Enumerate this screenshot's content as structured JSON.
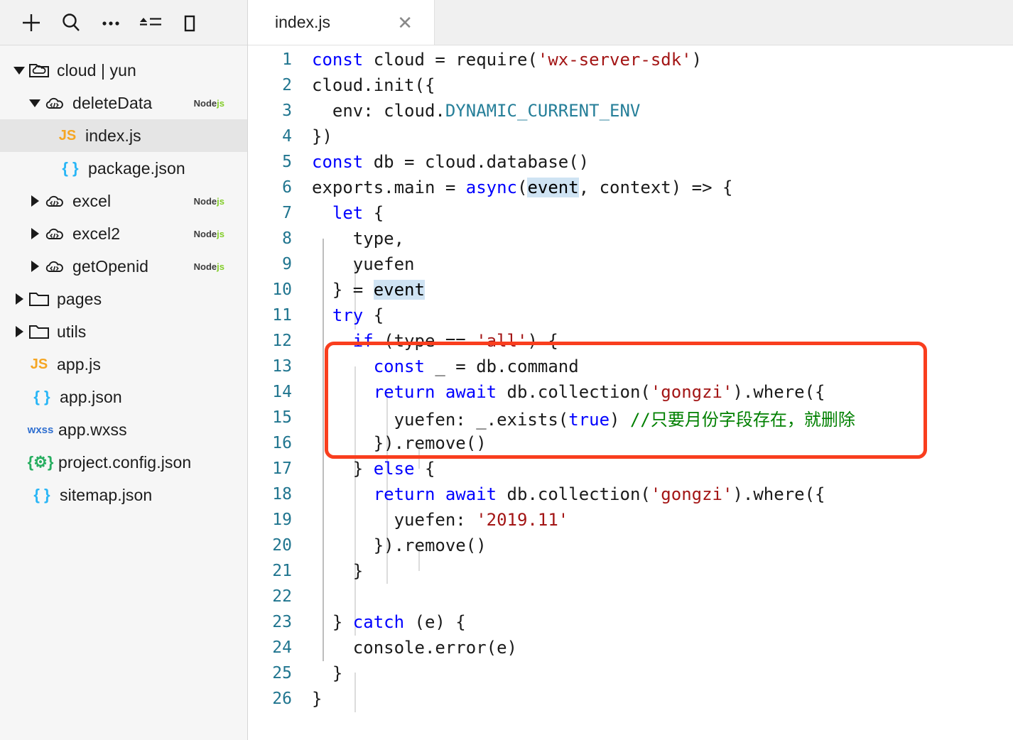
{
  "toolbar": {
    "buttons": [
      {
        "name": "add-file-button",
        "icon": "plus-icon",
        "title": "New"
      },
      {
        "name": "search-button",
        "icon": "search-icon",
        "title": "Search"
      },
      {
        "name": "more-options-button",
        "icon": "ellipsis-icon",
        "title": "More"
      },
      {
        "name": "sort-button",
        "icon": "sort-lines-icon",
        "title": "Sort"
      },
      {
        "name": "panel-toggle-button",
        "icon": "panel-icon",
        "title": "Toggle panel"
      }
    ]
  },
  "sidebar": {
    "items": [
      {
        "label": "cloud | yun",
        "icon": "cloud-folder-icon",
        "arrow": "down",
        "indent": 0,
        "badge": "",
        "selected": false
      },
      {
        "label": "deleteData",
        "icon": "cloud-function-icon",
        "arrow": "down",
        "indent": 1,
        "badge": "Nodejs",
        "selected": false
      },
      {
        "label": "index.js",
        "icon": "js-icon",
        "arrow": "none",
        "indent": 2,
        "badge": "",
        "selected": true
      },
      {
        "label": "package.json",
        "icon": "json-icon",
        "arrow": "none",
        "indent": 2,
        "badge": "",
        "selected": false
      },
      {
        "label": "excel",
        "icon": "cloud-function-icon",
        "arrow": "right",
        "indent": 1,
        "badge": "Nodejs",
        "selected": false
      },
      {
        "label": "excel2",
        "icon": "cloud-function-icon",
        "arrow": "right",
        "indent": 1,
        "badge": "Nodejs",
        "selected": false
      },
      {
        "label": "getOpenid",
        "icon": "cloud-function-icon",
        "arrow": "right",
        "indent": 1,
        "badge": "Nodejs",
        "selected": false
      },
      {
        "label": "pages",
        "icon": "folder-icon",
        "arrow": "right",
        "indent": 0,
        "badge": "",
        "selected": false
      },
      {
        "label": "utils",
        "icon": "folder-icon",
        "arrow": "right",
        "indent": 0,
        "badge": "",
        "selected": false
      },
      {
        "label": "app.js",
        "icon": "js-icon",
        "arrow": "none",
        "indent": 0,
        "badge": "",
        "selected": false
      },
      {
        "label": "app.json",
        "icon": "json-icon",
        "arrow": "none",
        "indent": 0,
        "badge": "",
        "selected": false
      },
      {
        "label": "app.wxss",
        "icon": "wxss-icon",
        "arrow": "none",
        "indent": 0,
        "badge": "",
        "selected": false
      },
      {
        "label": "project.config.json",
        "icon": "config-icon",
        "arrow": "none",
        "indent": 0,
        "badge": "",
        "selected": false
      },
      {
        "label": "sitemap.json",
        "icon": "json-icon",
        "arrow": "none",
        "indent": 0,
        "badge": "",
        "selected": false
      }
    ],
    "badge_node": "Node",
    "badge_js": "js"
  },
  "editor": {
    "tab": {
      "title": "index.js",
      "close": "✕"
    },
    "language": "javascript",
    "lines": [
      {
        "no": "1",
        "tokens": [
          {
            "t": "const",
            "c": "kw"
          },
          {
            "t": " cloud = require(",
            "c": "plain"
          },
          {
            "t": "'wx-server-sdk'",
            "c": "str"
          },
          {
            "t": ")",
            "c": "plain"
          }
        ]
      },
      {
        "no": "2",
        "tokens": [
          {
            "t": "cloud.init({",
            "c": "plain"
          }
        ]
      },
      {
        "no": "3",
        "tokens": [
          {
            "t": "  env: cloud.",
            "c": "plain"
          },
          {
            "t": "DYNAMIC_CURRENT_ENV",
            "c": "cls"
          }
        ]
      },
      {
        "no": "4",
        "tokens": [
          {
            "t": "})",
            "c": "plain"
          }
        ]
      },
      {
        "no": "5",
        "tokens": [
          {
            "t": "const",
            "c": "kw"
          },
          {
            "t": " db = cloud.database()",
            "c": "plain"
          }
        ]
      },
      {
        "no": "6",
        "tokens": [
          {
            "t": "exports.main = ",
            "c": "plain"
          },
          {
            "t": "async",
            "c": "kw"
          },
          {
            "t": "(",
            "c": "plain"
          },
          {
            "t": "event",
            "c": "hl"
          },
          {
            "t": ", context) => {",
            "c": "plain"
          }
        ]
      },
      {
        "no": "7",
        "tokens": [
          {
            "t": "  ",
            "c": "plain"
          },
          {
            "t": "let",
            "c": "kw"
          },
          {
            "t": " {",
            "c": "plain"
          }
        ]
      },
      {
        "no": "8",
        "tokens": [
          {
            "t": "    type,",
            "c": "plain"
          }
        ]
      },
      {
        "no": "9",
        "tokens": [
          {
            "t": "    yuefen",
            "c": "plain"
          }
        ]
      },
      {
        "no": "10",
        "tokens": [
          {
            "t": "  } = ",
            "c": "plain"
          },
          {
            "t": "event",
            "c": "hl"
          }
        ]
      },
      {
        "no": "11",
        "tokens": [
          {
            "t": "  ",
            "c": "plain"
          },
          {
            "t": "try",
            "c": "kw"
          },
          {
            "t": " {",
            "c": "plain"
          }
        ]
      },
      {
        "no": "12",
        "tokens": [
          {
            "t": "    ",
            "c": "plain"
          },
          {
            "t": "if",
            "c": "kw"
          },
          {
            "t": " (type == ",
            "c": "plain"
          },
          {
            "t": "'all'",
            "c": "str"
          },
          {
            "t": ") {",
            "c": "plain"
          }
        ]
      },
      {
        "no": "13",
        "tokens": [
          {
            "t": "      ",
            "c": "plain"
          },
          {
            "t": "const",
            "c": "kw"
          },
          {
            "t": " _ = db.command",
            "c": "plain"
          }
        ]
      },
      {
        "no": "14",
        "tokens": [
          {
            "t": "      ",
            "c": "plain"
          },
          {
            "t": "return",
            "c": "kw"
          },
          {
            "t": " ",
            "c": "plain"
          },
          {
            "t": "await",
            "c": "kw"
          },
          {
            "t": " db.collection(",
            "c": "plain"
          },
          {
            "t": "'gongzi'",
            "c": "str"
          },
          {
            "t": ").where({",
            "c": "plain"
          }
        ]
      },
      {
        "no": "15",
        "tokens": [
          {
            "t": "        yuefen: _.exists(",
            "c": "plain"
          },
          {
            "t": "true",
            "c": "kw"
          },
          {
            "t": ") ",
            "c": "plain"
          },
          {
            "t": "//只要月份字段存在，就删除",
            "c": "cmt"
          }
        ]
      },
      {
        "no": "16",
        "tokens": [
          {
            "t": "      }).remove()",
            "c": "plain"
          }
        ]
      },
      {
        "no": "17",
        "tokens": [
          {
            "t": "    } ",
            "c": "plain"
          },
          {
            "t": "else",
            "c": "kw"
          },
          {
            "t": " {",
            "c": "plain"
          }
        ]
      },
      {
        "no": "18",
        "tokens": [
          {
            "t": "      ",
            "c": "plain"
          },
          {
            "t": "return",
            "c": "kw"
          },
          {
            "t": " ",
            "c": "plain"
          },
          {
            "t": "await",
            "c": "kw"
          },
          {
            "t": " db.collection(",
            "c": "plain"
          },
          {
            "t": "'gongzi'",
            "c": "str"
          },
          {
            "t": ").where({",
            "c": "plain"
          }
        ]
      },
      {
        "no": "19",
        "tokens": [
          {
            "t": "        yuefen: ",
            "c": "plain"
          },
          {
            "t": "'2019.11'",
            "c": "str"
          }
        ]
      },
      {
        "no": "20",
        "tokens": [
          {
            "t": "      }).remove()",
            "c": "plain"
          }
        ]
      },
      {
        "no": "21",
        "tokens": [
          {
            "t": "    }",
            "c": "plain"
          }
        ]
      },
      {
        "no": "22",
        "tokens": [
          {
            "t": "",
            "c": "plain"
          }
        ]
      },
      {
        "no": "23",
        "tokens": [
          {
            "t": "  } ",
            "c": "plain"
          },
          {
            "t": "catch",
            "c": "kw"
          },
          {
            "t": " (e) {",
            "c": "plain"
          }
        ]
      },
      {
        "no": "24",
        "tokens": [
          {
            "t": "    console.error(e)",
            "c": "plain"
          }
        ]
      },
      {
        "no": "25",
        "tokens": [
          {
            "t": "  }",
            "c": "plain"
          }
        ]
      },
      {
        "no": "26",
        "tokens": [
          {
            "t": "}",
            "c": "plain"
          }
        ]
      }
    ]
  },
  "annotation": {
    "name": "highlight-box",
    "color": "#f93e1e",
    "covers_lines": [
      "13",
      "14",
      "15",
      "16"
    ]
  }
}
